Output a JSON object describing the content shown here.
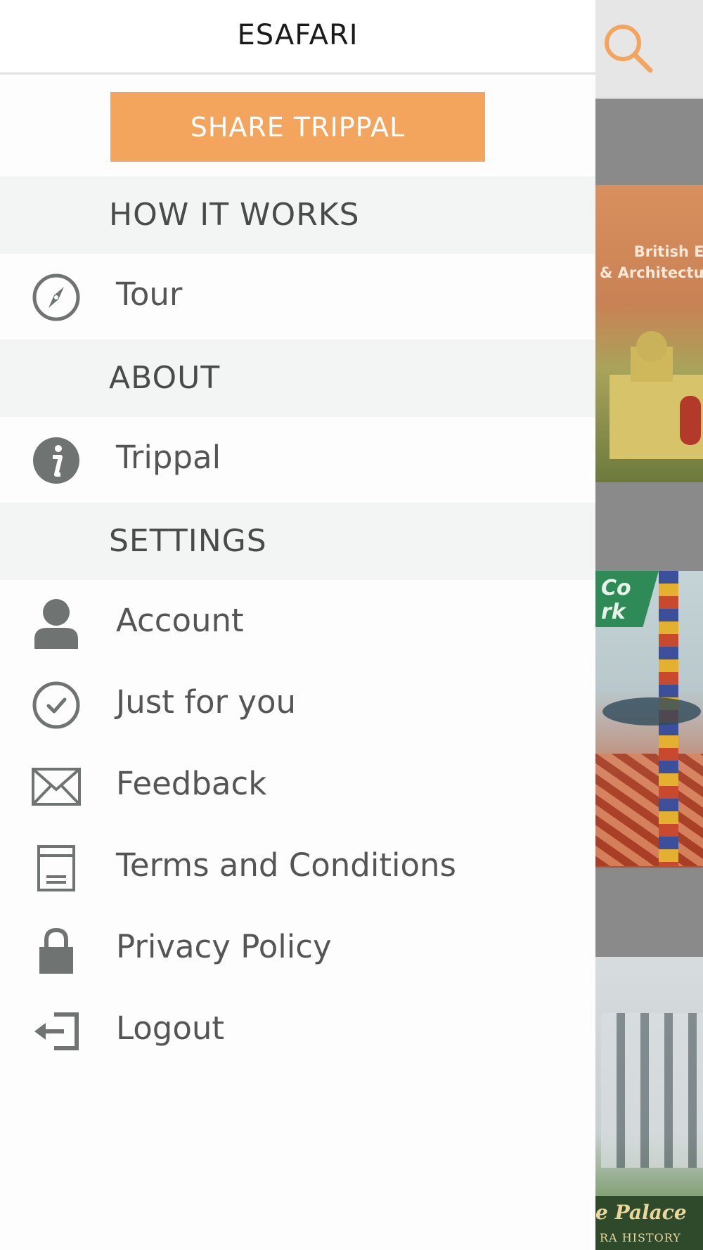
{
  "drawer": {
    "title": "ESAFARI",
    "share_label": "SHARE TRIPPAL",
    "sections": {
      "how_it_works": "HOW IT WORKS",
      "about": "ABOUT",
      "settings": "SETTINGS"
    },
    "items": {
      "tour": {
        "label": "Tour",
        "icon": "compass-icon"
      },
      "trippal": {
        "label": "Trippal",
        "icon": "info-icon"
      },
      "account": {
        "label": "Account",
        "icon": "person-icon"
      },
      "just_for_you": {
        "label": "Just for you",
        "icon": "check-circle-icon"
      },
      "feedback": {
        "label": "Feedback",
        "icon": "envelope-icon"
      },
      "terms": {
        "label": "Terms and Conditions",
        "icon": "document-icon"
      },
      "privacy": {
        "label": "Privacy Policy",
        "icon": "lock-icon"
      },
      "logout": {
        "label": "Logout",
        "icon": "logout-icon"
      }
    }
  },
  "background": {
    "search_icon": "search-icon",
    "cards": [
      {
        "text": "British Era\n& Architecture"
      },
      {
        "text": "Co\nrk"
      },
      {
        "title": "e Palace",
        "subtitle": "RA HISTORY"
      }
    ]
  },
  "colors": {
    "accent": "#f4a55d",
    "section_bg": "#f3f4f4",
    "text": "#555555",
    "icon": "#6f7473"
  }
}
